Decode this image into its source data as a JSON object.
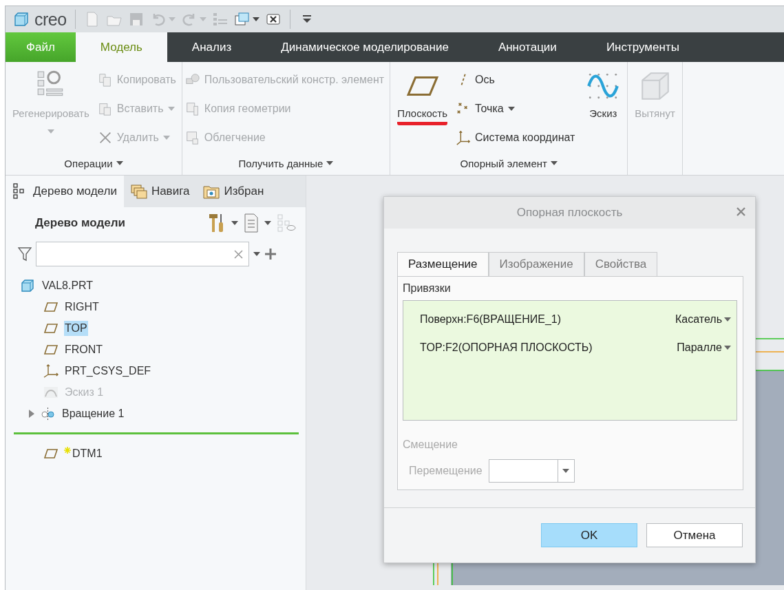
{
  "app": {
    "logo": "creo"
  },
  "quick_toolbar": [
    {
      "kind": "new",
      "disabled": true,
      "dropdown": false
    },
    {
      "kind": "open",
      "disabled": true,
      "dropdown": false
    },
    {
      "kind": "save",
      "disabled": true,
      "dropdown": false
    },
    {
      "kind": "undo",
      "disabled": true,
      "dropdown": true
    },
    {
      "kind": "redo",
      "disabled": true,
      "dropdown": true
    },
    {
      "kind": "regenerate",
      "disabled": true,
      "dropdown": false
    },
    {
      "kind": "windows",
      "disabled": false,
      "dropdown": true
    },
    {
      "kind": "close",
      "disabled": false,
      "dropdown": false
    },
    {
      "kind": "customize",
      "disabled": false,
      "dropdown": false
    }
  ],
  "ribbon_tabs": [
    {
      "label": "Файл",
      "kind": "file",
      "selected": false
    },
    {
      "label": "Модель",
      "kind": "tab",
      "selected": true
    },
    {
      "label": "Анализ",
      "kind": "tab",
      "selected": false
    },
    {
      "label": "Динамическое моделирование",
      "kind": "tab",
      "selected": false
    },
    {
      "label": "Аннотации",
      "kind": "tab",
      "selected": false
    },
    {
      "label": "Инструменты",
      "kind": "tab",
      "selected": false
    }
  ],
  "ribbon_groups": [
    {
      "label": "Операции",
      "items": [
        {
          "label": "Регенерировать",
          "kind": "regenerate",
          "large": true,
          "disabled": true,
          "dropdown": true,
          "underlined": false
        },
        {
          "label": "Копировать",
          "kind": "copy",
          "large": false,
          "disabled": true,
          "dropdown": false,
          "underlined": false
        },
        {
          "label": "Вставить",
          "kind": "paste",
          "large": false,
          "disabled": true,
          "dropdown": true,
          "underlined": false
        },
        {
          "label": "Удалить",
          "kind": "delete",
          "large": false,
          "disabled": true,
          "dropdown": true,
          "underlined": false
        }
      ]
    },
    {
      "label": "Получить данные",
      "items": [
        {
          "label": "Пользовательский констр. элемент",
          "kind": "udf",
          "large": false,
          "disabled": true,
          "dropdown": false,
          "underlined": false
        },
        {
          "label": "Копия геометрии",
          "kind": "copygeom",
          "large": false,
          "disabled": true,
          "dropdown": false,
          "underlined": false
        },
        {
          "label": "Облегчение",
          "kind": "shrinkwrap",
          "large": false,
          "disabled": true,
          "dropdown": false,
          "underlined": false
        }
      ]
    },
    {
      "label": "Опорный элемент",
      "items": [
        {
          "label": "Плоскость",
          "kind": "plane",
          "large": true,
          "disabled": false,
          "dropdown": false,
          "underlined": true
        },
        {
          "label": "Ось",
          "kind": "axis",
          "large": false,
          "disabled": false,
          "dropdown": false,
          "underlined": false
        },
        {
          "label": "Точка",
          "kind": "point",
          "large": false,
          "disabled": false,
          "dropdown": true,
          "underlined": false
        },
        {
          "label": "Система координат",
          "kind": "csys",
          "large": false,
          "disabled": false,
          "dropdown": false,
          "underlined": false
        },
        {
          "label": "Эскиз",
          "kind": "sketch",
          "large": true,
          "disabled": false,
          "dropdown": false,
          "underlined": false
        }
      ]
    },
    {
      "items": [
        {
          "label": "Вытянут",
          "kind": "extrude",
          "large": true,
          "disabled": true,
          "dropdown": false,
          "underlined": false
        }
      ]
    }
  ],
  "model_tree": {
    "tabs": [
      {
        "label": "Дерево модели",
        "kind": "tree",
        "selected": true
      },
      {
        "label": "Навига",
        "kind": "folders",
        "selected": false
      },
      {
        "label": "Избран",
        "kind": "favorites",
        "selected": false
      }
    ],
    "title": "Дерево модели",
    "items": [
      {
        "label": "VAL8.PRT",
        "kind": "part",
        "selected": false,
        "disabled": false,
        "children": [
          {
            "label": "RIGHT",
            "kind": "plane",
            "selected": false,
            "disabled": false
          },
          {
            "label": "TOP",
            "kind": "plane",
            "selected": true,
            "disabled": false
          },
          {
            "label": "FRONT",
            "kind": "plane",
            "selected": false,
            "disabled": false
          },
          {
            "label": "PRT_CSYS_DEF",
            "kind": "csys",
            "selected": false,
            "disabled": false
          },
          {
            "label": "Эскиз 1",
            "kind": "sketch",
            "selected": false,
            "disabled": true
          },
          {
            "label": "Вращение 1",
            "kind": "revolve",
            "selected": false,
            "disabled": false,
            "expanded": false
          },
          {
            "kind": "insert"
          },
          {
            "label": "DTM1",
            "kind": "plane",
            "selected": false,
            "disabled": false,
            "new": true
          }
        ]
      }
    ]
  },
  "dialog": {
    "title": "Опорная плоскость",
    "tabs": [
      {
        "label": "Размещение",
        "selected": true
      },
      {
        "label": "Изображение",
        "selected": false
      },
      {
        "label": "Свойства",
        "selected": false
      }
    ],
    "references_label": "Привязки",
    "references": [
      {
        "reference": "Поверхн:F6(ВРАЩЕНИЕ_1)",
        "constraint": "Касатель"
      },
      {
        "reference": "TOP:F2(ОПОРНАЯ ПЛОСКОСТЬ)",
        "constraint": "Паралле"
      }
    ],
    "offset_label": "Смещение",
    "offset_disabled": true,
    "translation_label": "Перемещение",
    "buttons": [
      {
        "label": "OK",
        "primary": true
      },
      {
        "label": "Отмена",
        "primary": false
      }
    ]
  }
}
